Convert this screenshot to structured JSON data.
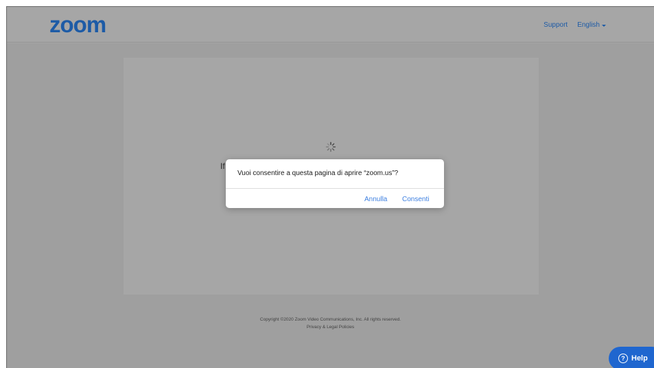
{
  "header": {
    "logo": "zoom",
    "support_label": "Support",
    "language_label": "English"
  },
  "main": {
    "partial_text": "If"
  },
  "footer": {
    "copyright": "Copyright ©2020 Zoom Video Communications, Inc. All rights reserved.",
    "privacy_link": "Privacy & Legal Policies"
  },
  "dialog": {
    "message": "Vuoi consentire a questa pagina di aprire “zoom.us”?",
    "cancel_label": "Annulla",
    "allow_label": "Consenti"
  },
  "help": {
    "label": "Help",
    "icon_glyph": "?"
  },
  "colors": {
    "brand": "#2d8cff",
    "dialog_button": "#3d7fe0",
    "help_button": "#1f66cf"
  },
  "icons": {
    "spinner": "loading-spinner-icon",
    "caret": "caret-down-icon",
    "help": "question-circle-icon"
  }
}
